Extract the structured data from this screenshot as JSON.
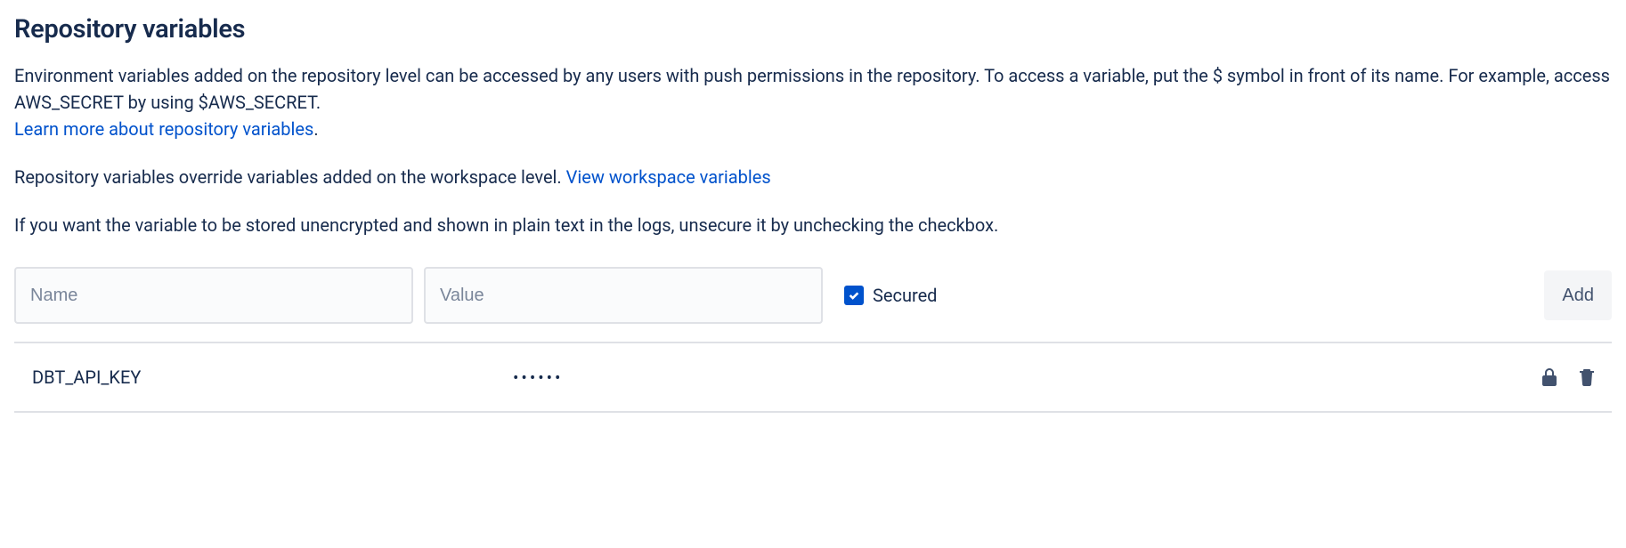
{
  "header": {
    "title": "Repository variables"
  },
  "description": {
    "text1": "Environment variables added on the repository level can be accessed by any users with push permissions in the repository. To access a variable, put the $ symbol in front of its name. For example, access AWS_SECRET by using $AWS_SECRET.",
    "learn_more_link": "Learn more about repository variables",
    "period": "."
  },
  "override_note": {
    "text": "Repository variables override variables added on the workspace level. ",
    "view_link": "View workspace variables"
  },
  "unsecure_note": {
    "text": "If you want the variable to be stored unencrypted and shown in plain text in the logs, unsecure it by unchecking the checkbox."
  },
  "form": {
    "name_placeholder": "Name",
    "value_placeholder": "Value",
    "secured_label": "Secured",
    "secured_checked": true,
    "add_button": "Add"
  },
  "variables": [
    {
      "name": "DBT_API_KEY",
      "value_masked": "••••••",
      "secured": true
    }
  ]
}
